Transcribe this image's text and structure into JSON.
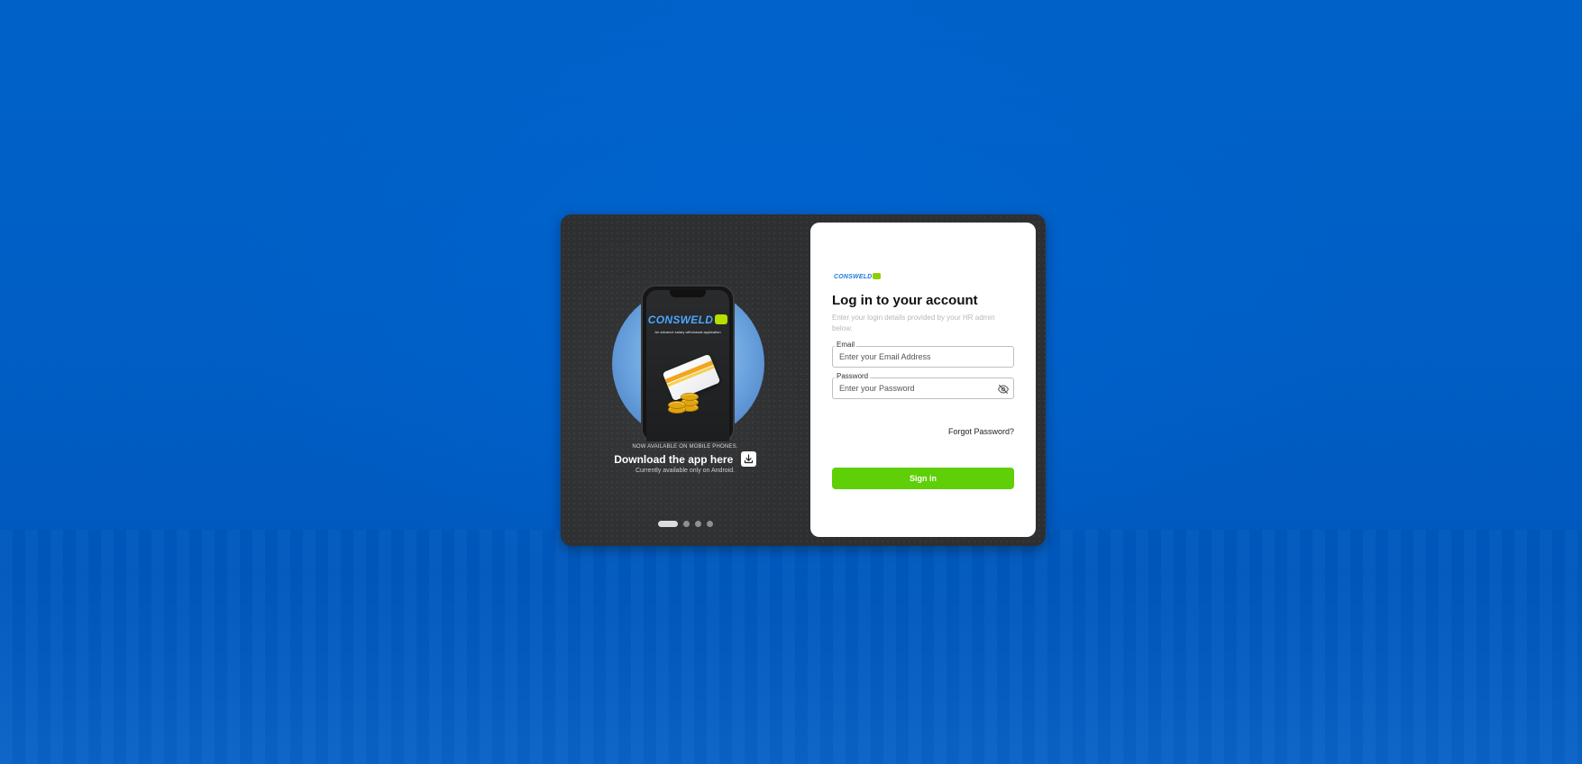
{
  "colors": {
    "background_blue": "#005ec4",
    "card_dark": "#2e2f31",
    "accent_green": "#5fcf08",
    "brand_blue": "#1f7ad8",
    "brand_mark_green": "#8bd000"
  },
  "promo": {
    "phone_brand": "CONSWELD",
    "phone_tagline": "An advance salary withdrawal application",
    "eyebrow": "NOW AVAILABLE ON MOBILE PHONES.",
    "title": "Download the app here",
    "subtitle": "Currently available only on Android.",
    "download_icon": "download-icon",
    "carousel": {
      "slide_count": 4,
      "active_index": 0
    }
  },
  "login": {
    "logo_text": "CONSWELD",
    "title": "Log in to your account",
    "description": "Enter your login details provided by your HR admin below.",
    "email": {
      "label": "Email",
      "placeholder": "Enter your Email Address",
      "value": ""
    },
    "password": {
      "label": "Password",
      "placeholder": "Enter your Password",
      "value": "",
      "toggle_icon": "eye-off-icon"
    },
    "forgot_password": "Forgot Password?",
    "submit_label": "Sign in"
  }
}
